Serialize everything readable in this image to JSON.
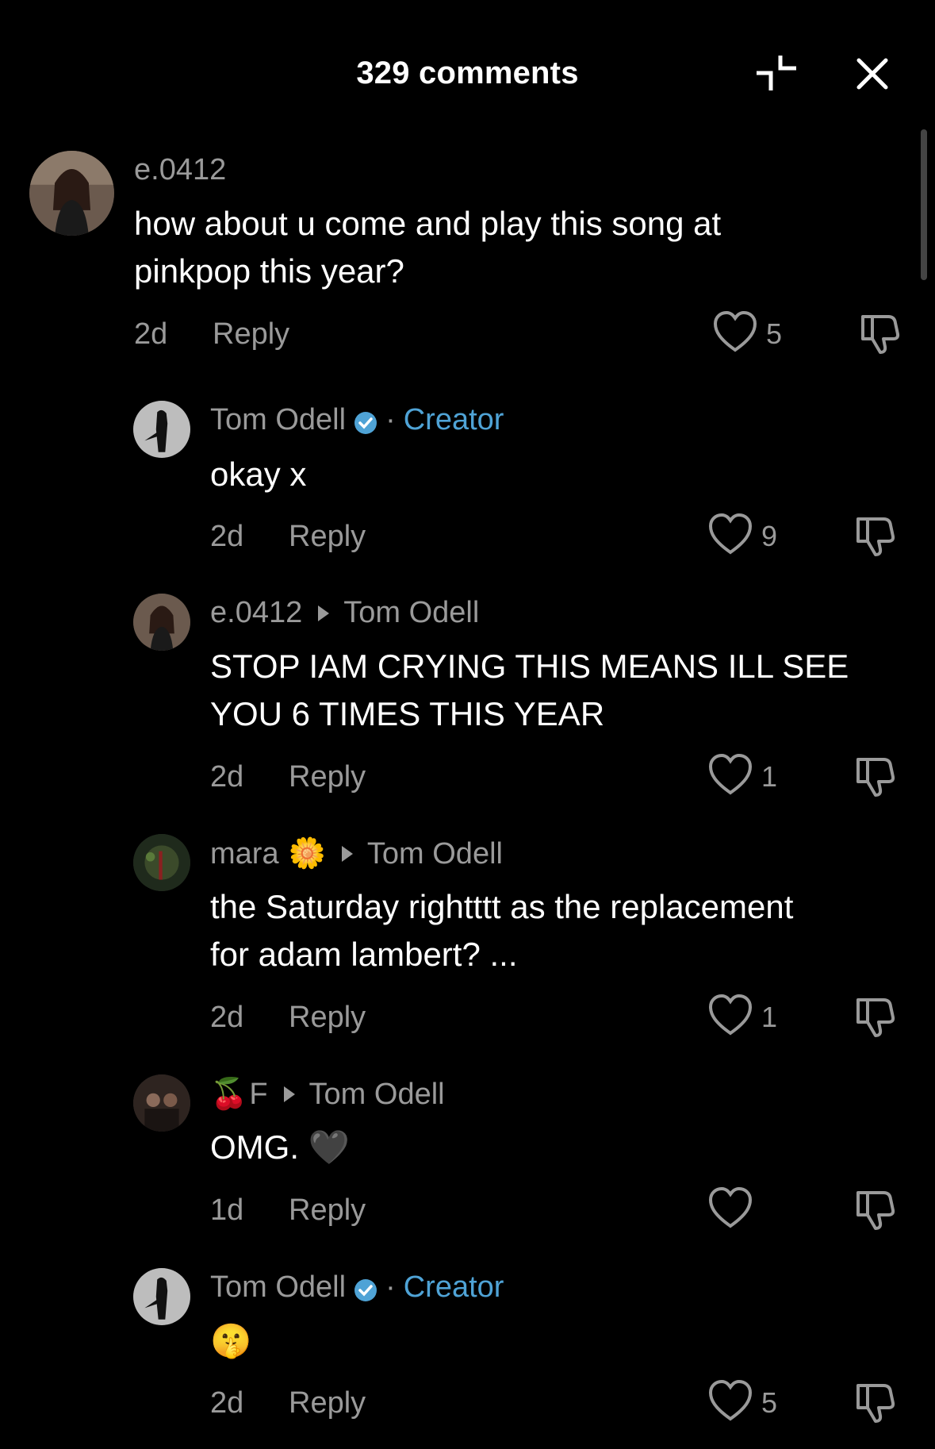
{
  "header": {
    "title": "329 comments"
  },
  "comments": [
    {
      "username": "e.0412",
      "text": "how about u come and play this song at\npinkpop this year?",
      "time": "2d",
      "reply_label": "Reply",
      "likes": "5"
    },
    {
      "username": "Tom Odell",
      "creator_label": "Creator",
      "text": "okay x",
      "time": "2d",
      "reply_label": "Reply",
      "likes": "9"
    },
    {
      "username": "e.0412",
      "reply_to": "Tom Odell",
      "text": "STOP IAM CRYING THIS MEANS ILL SEE\nYOU 6 TIMES THIS YEAR",
      "time": "2d",
      "reply_label": "Reply",
      "likes": "1"
    },
    {
      "username": "mara",
      "username_emoji": "🌼",
      "reply_to": "Tom Odell",
      "text": "the Saturday rightttt as the replacement\nfor adam lambert? ...",
      "time": "2d",
      "reply_label": "Reply",
      "likes": "1"
    },
    {
      "username_emoji": "🍒",
      "username": "F",
      "reply_to": "Tom Odell",
      "text": "OMG. 🖤",
      "time": "1d",
      "reply_label": "Reply",
      "likes": ""
    },
    {
      "username": "Tom Odell",
      "creator_label": "Creator",
      "text": "🤫",
      "time": "2d",
      "reply_label": "Reply",
      "likes": "5"
    }
  ],
  "colors": {
    "background": "#000000",
    "muted": "#9a9a9a",
    "creator": "#4fa3d6"
  },
  "icons": [
    "shrink-icon",
    "close-icon",
    "heart-icon",
    "dislike-icon",
    "verified-badge-icon"
  ]
}
